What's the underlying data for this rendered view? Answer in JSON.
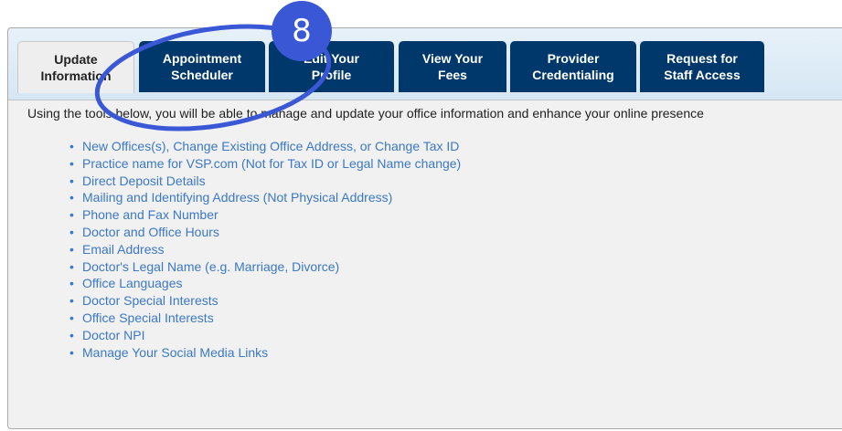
{
  "tabs": [
    {
      "label": "Update\nInformation",
      "active": true
    },
    {
      "label": "Appointment\nScheduler",
      "active": false
    },
    {
      "label": "Edit Your\nProfile",
      "active": false
    },
    {
      "label": "View Your\nFees",
      "active": false
    },
    {
      "label": "Provider\nCredentialing",
      "active": false
    },
    {
      "label": "Request for\nStaff Access",
      "active": false
    }
  ],
  "intro_text": "Using the tools below, you will be able to manage and update your office information and enhance your online presence",
  "links": [
    "New Offices(s), Change Existing Office Address, or Change Tax ID",
    "Practice name for VSP.com (Not for Tax ID or Legal Name change)",
    "Direct Deposit Details",
    "Mailing and Identifying Address (Not Physical Address)",
    "Phone and Fax Number",
    "Doctor and Office Hours",
    "Email Address",
    "Doctor's Legal Name (e.g. Marriage, Divorce)",
    "Office Languages",
    "Doctor Special Interests",
    "Office Special Interests",
    "Doctor NPI",
    "Manage Your Social Media Links"
  ],
  "annotation": {
    "number": "8",
    "color": "#3a57d6"
  },
  "colors": {
    "tab_bg": "#00386b",
    "link": "#3b78c6"
  }
}
